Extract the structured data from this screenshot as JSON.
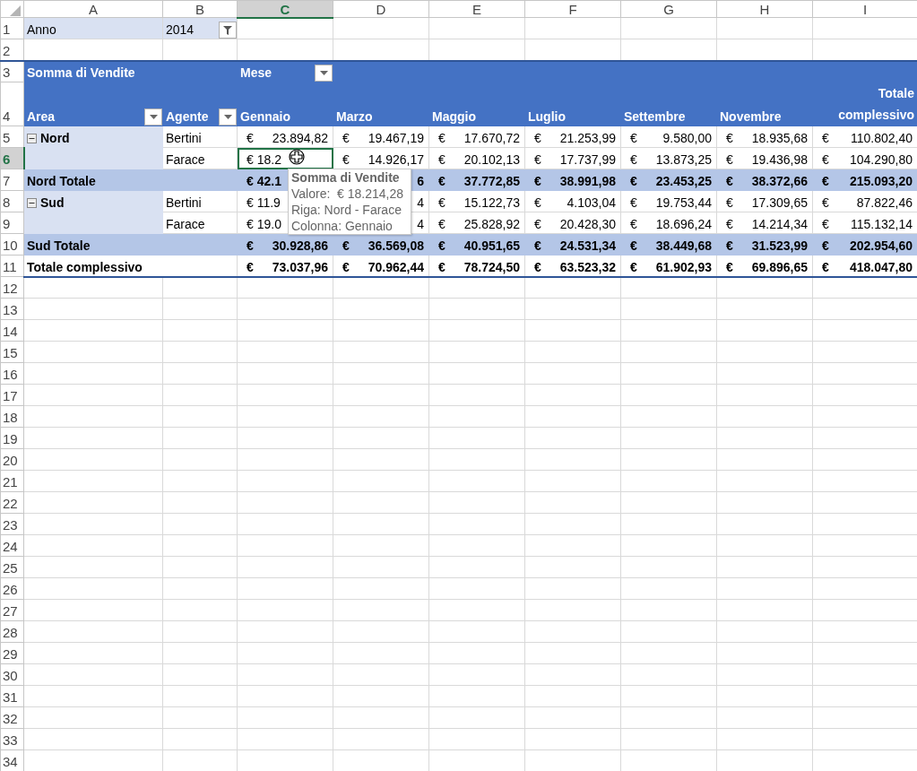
{
  "column_headers": [
    {
      "label": "A",
      "selected": false
    },
    {
      "label": "B",
      "selected": false
    },
    {
      "label": "C",
      "selected": true
    },
    {
      "label": "D",
      "selected": false
    },
    {
      "label": "E",
      "selected": false
    },
    {
      "label": "F",
      "selected": false
    },
    {
      "label": "G",
      "selected": false
    },
    {
      "label": "H",
      "selected": false
    },
    {
      "label": "I",
      "selected": false
    }
  ],
  "row_headers": [
    {
      "label": "1",
      "selected": false
    },
    {
      "label": "2",
      "selected": false
    },
    {
      "label": "3",
      "selected": false
    },
    {
      "label": "4",
      "selected": false
    },
    {
      "label": "5",
      "selected": false
    },
    {
      "label": "6",
      "selected": true
    },
    {
      "label": "7",
      "selected": false
    },
    {
      "label": "8",
      "selected": false
    },
    {
      "label": "9",
      "selected": false
    },
    {
      "label": "10",
      "selected": false
    },
    {
      "label": "11",
      "selected": false
    },
    {
      "label": "12",
      "selected": false
    },
    {
      "label": "13",
      "selected": false
    },
    {
      "label": "14",
      "selected": false
    },
    {
      "label": "15",
      "selected": false
    },
    {
      "label": "16",
      "selected": false
    },
    {
      "label": "17",
      "selected": false
    },
    {
      "label": "18",
      "selected": false
    },
    {
      "label": "19",
      "selected": false
    },
    {
      "label": "20",
      "selected": false
    },
    {
      "label": "21",
      "selected": false
    },
    {
      "label": "22",
      "selected": false
    },
    {
      "label": "23",
      "selected": false
    },
    {
      "label": "24",
      "selected": false
    },
    {
      "label": "25",
      "selected": false
    },
    {
      "label": "26",
      "selected": false
    },
    {
      "label": "27",
      "selected": false
    },
    {
      "label": "28",
      "selected": false
    },
    {
      "label": "29",
      "selected": false
    },
    {
      "label": "30",
      "selected": false
    },
    {
      "label": "31",
      "selected": false
    },
    {
      "label": "32",
      "selected": false
    },
    {
      "label": "33",
      "selected": false
    },
    {
      "label": "34",
      "selected": false
    }
  ],
  "report_filter": {
    "label": "Anno",
    "value": "2014",
    "filtered": true
  },
  "pivot": {
    "value_label": "Somma di Vendite",
    "column_field": "Mese",
    "row_fields": [
      "Area",
      "Agente"
    ],
    "columns": [
      "Gennaio",
      "Marzo",
      "Maggio",
      "Luglio",
      "Settembre",
      "Novembre"
    ],
    "total_column": "Totale complessivo",
    "rows": [
      {
        "kind": "item",
        "area": "Nord",
        "expanded": true,
        "agent": "Bertini",
        "cells": [
          {
            "kind": "full",
            "text": "€ 23.894,82",
            "selected": false
          },
          {
            "kind": "full",
            "text": "€ 19.467,19",
            "selected": false
          },
          {
            "kind": "full",
            "text": "€ 17.670,72",
            "selected": false
          },
          {
            "kind": "full",
            "text": "€ 21.253,99",
            "selected": false
          },
          {
            "kind": "full",
            "text": "€ 9.580,00",
            "selected": false
          },
          {
            "kind": "full",
            "text": "€ 18.935,68",
            "selected": false
          },
          {
            "kind": "full",
            "text": "€ 110.802,40",
            "selected": false
          }
        ]
      },
      {
        "kind": "item",
        "agent": "Farace",
        "cells": [
          {
            "kind": "clip-left",
            "text": "€ 18.2",
            "selected": true
          },
          {
            "kind": "full",
            "text": "€ 14.926,17",
            "selected": false
          },
          {
            "kind": "full",
            "text": "€ 20.102,13",
            "selected": false
          },
          {
            "kind": "full",
            "text": "€ 17.737,99",
            "selected": false
          },
          {
            "kind": "full",
            "text": "€ 13.873,25",
            "selected": false
          },
          {
            "kind": "full",
            "text": "€ 19.436,98",
            "selected": false
          },
          {
            "kind": "full",
            "text": "€ 104.290,80",
            "selected": false
          }
        ]
      },
      {
        "kind": "subtotal",
        "label": "Nord Totale",
        "cells": [
          {
            "kind": "clip-left",
            "text": "€ 42.1",
            "selected": false
          },
          {
            "kind": "clip-right",
            "text": "6",
            "selected": false
          },
          {
            "kind": "full",
            "text": "€ 37.772,85",
            "selected": false
          },
          {
            "kind": "full",
            "text": "€ 38.991,98",
            "selected": false
          },
          {
            "kind": "full",
            "text": "€ 23.453,25",
            "selected": false
          },
          {
            "kind": "full",
            "text": "€ 38.372,66",
            "selected": false
          },
          {
            "kind": "full",
            "text": "€ 215.093,20",
            "selected": false
          }
        ]
      },
      {
        "kind": "item",
        "area": "Sud",
        "expanded": true,
        "agent": "Bertini",
        "cells": [
          {
            "kind": "clip-left",
            "text": "€ 11.9",
            "selected": false
          },
          {
            "kind": "clip-right",
            "text": "4",
            "selected": false
          },
          {
            "kind": "full",
            "text": "€ 15.122,73",
            "selected": false
          },
          {
            "kind": "full",
            "text": "€ 4.103,04",
            "selected": false
          },
          {
            "kind": "full",
            "text": "€ 19.753,44",
            "selected": false
          },
          {
            "kind": "full",
            "text": "€ 17.309,65",
            "selected": false
          },
          {
            "kind": "full",
            "text": "€ 87.822,46",
            "selected": false
          }
        ]
      },
      {
        "kind": "item",
        "agent": "Farace",
        "cells": [
          {
            "kind": "clip-left",
            "text": "€ 19.0",
            "selected": false
          },
          {
            "kind": "clip-right",
            "text": "4",
            "selected": false
          },
          {
            "kind": "full",
            "text": "€ 25.828,92",
            "selected": false
          },
          {
            "kind": "full",
            "text": "€ 20.428,30",
            "selected": false
          },
          {
            "kind": "full",
            "text": "€ 18.696,24",
            "selected": false
          },
          {
            "kind": "full",
            "text": "€ 14.214,34",
            "selected": false
          },
          {
            "kind": "full",
            "text": "€ 115.132,14",
            "selected": false
          }
        ]
      },
      {
        "kind": "subtotal",
        "label": "Sud Totale",
        "cells": [
          {
            "kind": "full",
            "text": "€ 30.928,86",
            "selected": false
          },
          {
            "kind": "full",
            "text": "€ 36.569,08",
            "selected": false
          },
          {
            "kind": "full",
            "text": "€ 40.951,65",
            "selected": false
          },
          {
            "kind": "full",
            "text": "€ 24.531,34",
            "selected": false
          },
          {
            "kind": "full",
            "text": "€ 38.449,68",
            "selected": false
          },
          {
            "kind": "full",
            "text": "€ 31.523,99",
            "selected": false
          },
          {
            "kind": "full",
            "text": "€ 202.954,60",
            "selected": false
          }
        ]
      },
      {
        "kind": "grand",
        "label": "Totale complessivo",
        "cells": [
          {
            "kind": "full",
            "text": "€ 73.037,96",
            "selected": false
          },
          {
            "kind": "full",
            "text": "€ 70.962,44",
            "selected": false
          },
          {
            "kind": "full",
            "text": "€ 78.724,50",
            "selected": false
          },
          {
            "kind": "full",
            "text": "€ 63.523,32",
            "selected": false
          },
          {
            "kind": "full",
            "text": "€ 61.902,93",
            "selected": false
          },
          {
            "kind": "full",
            "text": "€ 69.896,65",
            "selected": false
          },
          {
            "kind": "full",
            "text": "€ 418.047,80",
            "selected": false
          }
        ]
      }
    ]
  },
  "tooltip": {
    "title": "Somma di Vendite",
    "lines": [
      "Valore:  € 18.214,28",
      "Riga: Nord - Farace",
      "Colonna: Gennaio"
    ]
  }
}
